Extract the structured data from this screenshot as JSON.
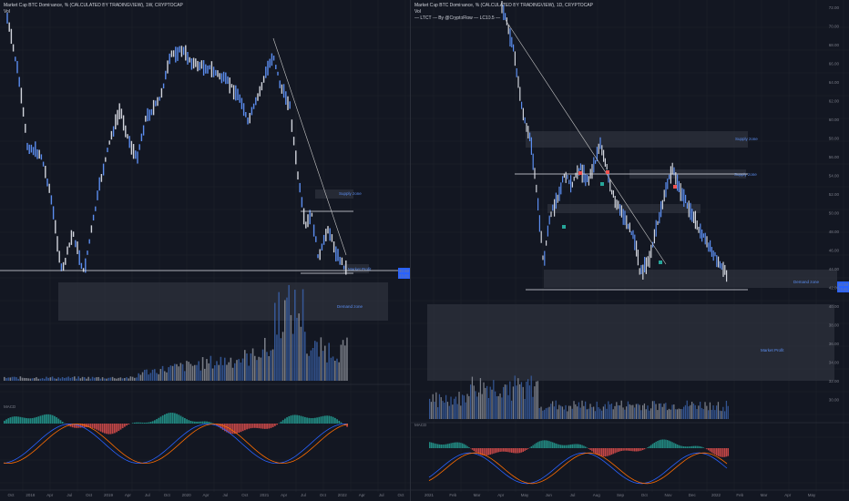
{
  "left": {
    "legend_line1": "Market Cap BTC Dominance, % (CALCULATED BY TRADINGVIEW), 1W, CRYPTOCAP",
    "legend_line2": "Vol",
    "indicator_label": "MACD",
    "x_ticks": [
      "Oct",
      "2018",
      "Apr",
      "Jul",
      "Oct",
      "2019",
      "Apr",
      "Jul",
      "Oct",
      "2020",
      "Apr",
      "Jul",
      "Oct",
      "2021",
      "Apr",
      "Jul",
      "Oct",
      "2022",
      "Apr",
      "Jul",
      "Oct"
    ],
    "zones": [
      "Supply zone",
      "Market Profit",
      "Demand zone"
    ],
    "price_badges": [
      "40.50",
      "23.81"
    ]
  },
  "right": {
    "legend_line1": "Market Cap BTC Dominance, % (CALCULATED BY TRADINGVIEW), 1D, CRYPTOCAP",
    "legend_line2": "Vol",
    "legend_line3": "— LTCT — By @CryptoFlow — LC10.5 —",
    "indicator_label": "MACD",
    "x_ticks": [
      "2021",
      "Feb",
      "Mar",
      "Apr",
      "May",
      "Jun",
      "Jul",
      "Aug",
      "Sep",
      "Oct",
      "Nov",
      "Dec",
      "2022",
      "Feb",
      "Mar",
      "Apr",
      "May"
    ],
    "y_ticks": [
      "72.00",
      "70.00",
      "68.00",
      "66.00",
      "64.00",
      "62.00",
      "60.00",
      "58.00",
      "56.00",
      "54.00",
      "52.00",
      "50.00",
      "48.00",
      "46.00",
      "44.00",
      "42.00",
      "40.00",
      "38.00",
      "36.00",
      "34.00",
      "32.00",
      "30.00"
    ],
    "zones": [
      "Supply zone",
      "Supply zone",
      "Demand zone",
      "Market Profit"
    ],
    "price_badges": [
      "40.50",
      "23.81"
    ]
  },
  "colors": {
    "background": "#131722",
    "price_line": "#5b8def",
    "bull": "#26a69a",
    "bear": "#ef5350",
    "zone": "#363a45",
    "macd": "#2962ff",
    "signal": "#ff6d00"
  }
}
